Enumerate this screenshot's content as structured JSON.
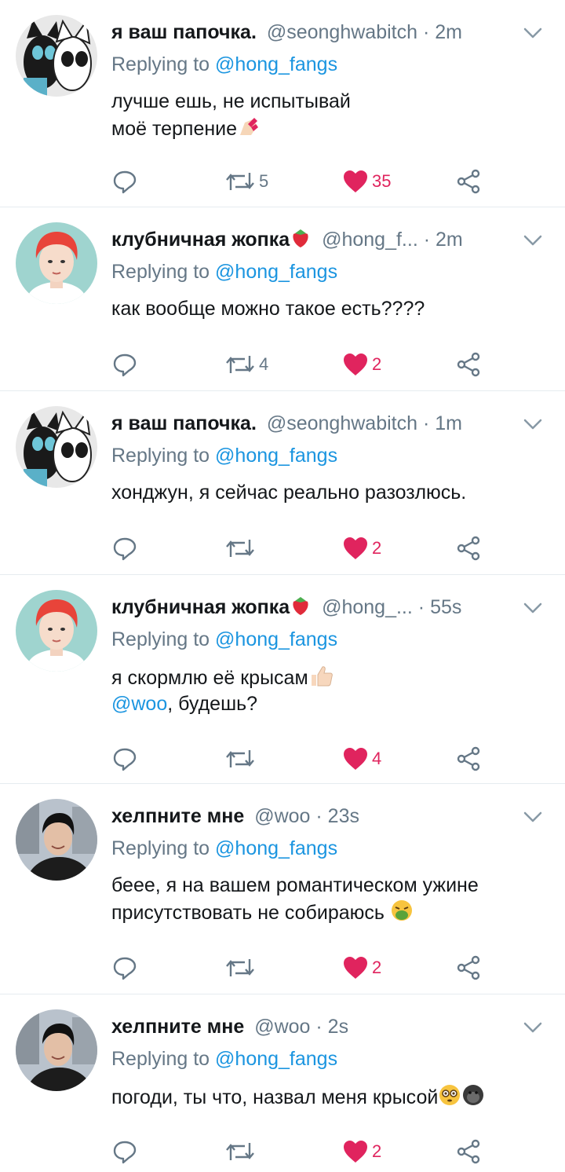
{
  "tweets": [
    {
      "name": "я ваш папочка.",
      "handle": "@seonghwabitch",
      "time": "2m",
      "reply_prefix": "Replying to",
      "reply_to": "@hong_fangs",
      "lines": [
        "лучше ешь, не испытывай",
        "моё терпение"
      ],
      "emoji": "nail-polish-icon",
      "retweets": "5",
      "likes": "35",
      "avatar": "cats"
    },
    {
      "name": "клубничная жопка",
      "handle": "@hong_f...",
      "time": "2m",
      "reply_prefix": "Replying to",
      "reply_to": "@hong_fangs",
      "lines": [
        "как вообще можно такое есть????"
      ],
      "retweets": "4",
      "likes": "2",
      "avatar": "redhair"
    },
    {
      "name": "я ваш папочка.",
      "handle": "@seonghwabitch",
      "time": "1m",
      "reply_prefix": "Replying to",
      "reply_to": "@hong_fangs",
      "lines": [
        "хонджун, я сейчас реально разозлюсь."
      ],
      "retweets": "",
      "likes": "2",
      "avatar": "cats"
    },
    {
      "name": "клубничная жопка",
      "handle": "@hong_...",
      "time": "55s",
      "reply_prefix": "Replying to",
      "reply_to": "@hong_fangs",
      "lines": [
        "я скормлю её крысам"
      ],
      "line2_mention": "@woo",
      "line2_rest": ", будешь?",
      "retweets": "",
      "likes": "4",
      "avatar": "redhair"
    },
    {
      "name": "хелпните мне",
      "handle": "@woo",
      "time": "23s",
      "reply_prefix": "Replying to",
      "reply_to": "@hong_fangs",
      "lines": [
        "беее, я на вашем романтическом ужине",
        "присутствовать не собираюсь"
      ],
      "retweets": "",
      "likes": "2",
      "avatar": "woo"
    },
    {
      "name": "хелпните мне",
      "handle": "@woo",
      "time": "2s",
      "reply_prefix": "Replying to",
      "reply_to": "@hong_fangs",
      "lines": [
        "погоди, ты что, назвал меня крысой"
      ],
      "retweets": "",
      "likes": "2",
      "avatar": "woo"
    }
  ],
  "sep": "·",
  "colors": {
    "link": "#1b95e0",
    "secondary": "#657786",
    "like": "#e0245e",
    "divider": "#e6ecf0"
  }
}
